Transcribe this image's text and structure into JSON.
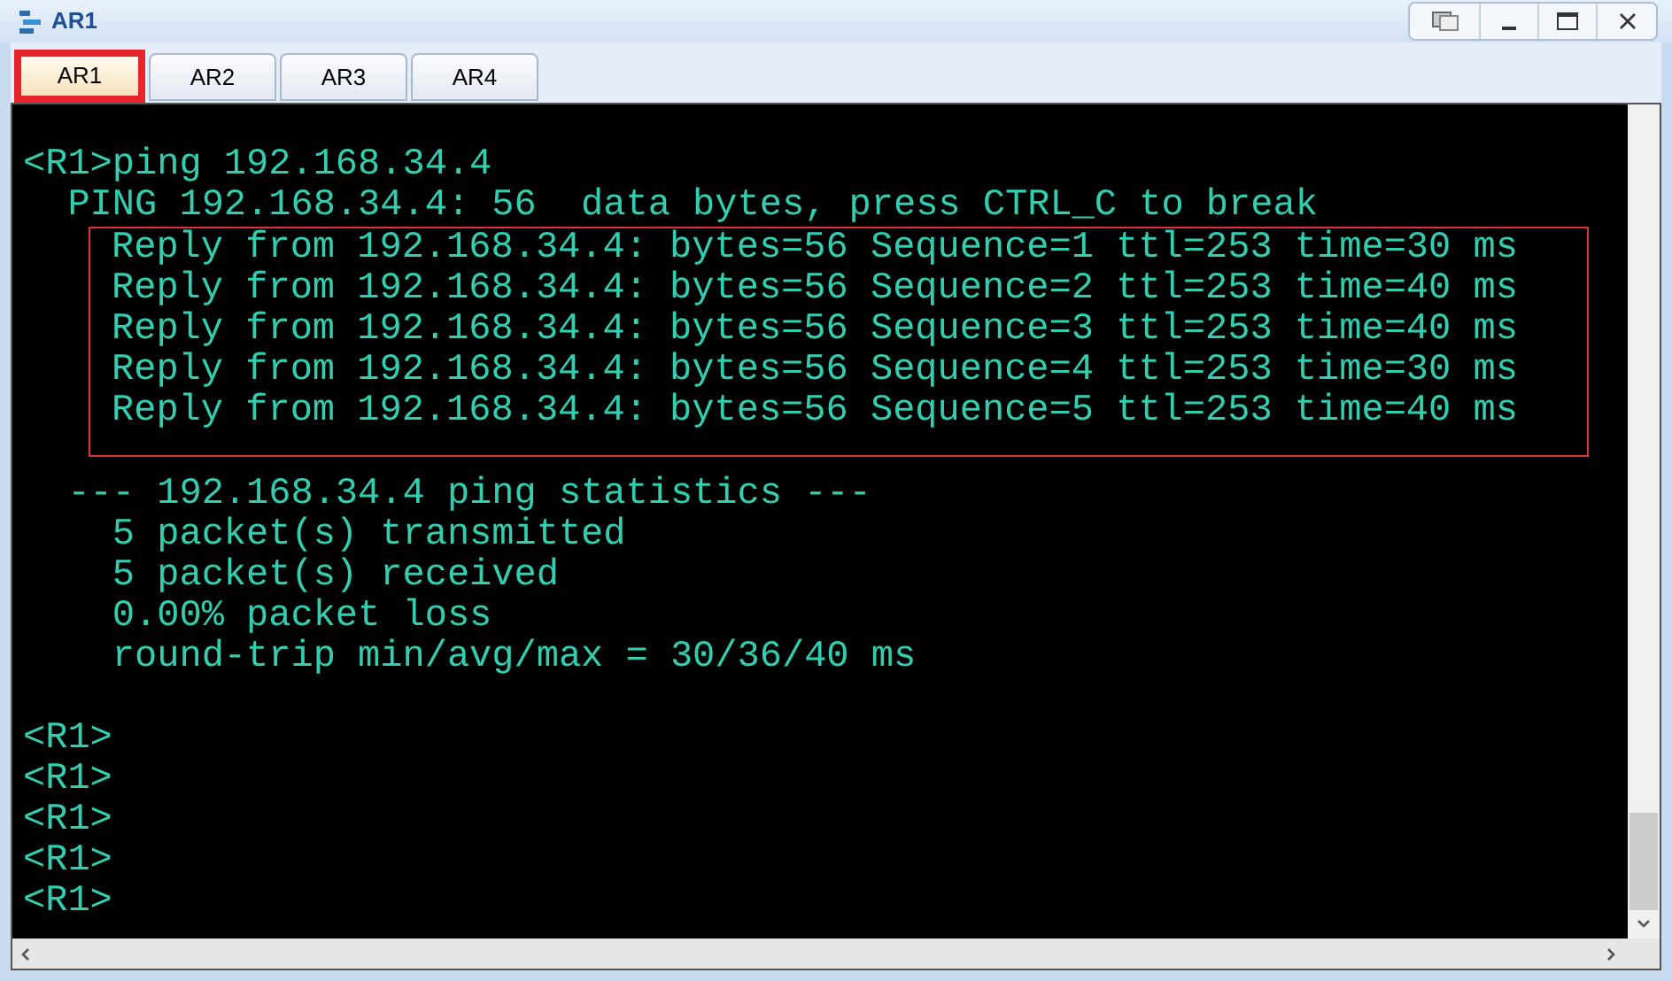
{
  "window": {
    "title": "AR1"
  },
  "tabs": [
    {
      "label": "AR1",
      "selected": true
    },
    {
      "label": "AR2",
      "selected": false
    },
    {
      "label": "AR3",
      "selected": false
    },
    {
      "label": "AR4",
      "selected": false
    }
  ],
  "terminal": {
    "lines_before": [
      "<R1>ping 192.168.34.4",
      "  PING 192.168.34.4: 56  data bytes, press CTRL_C to break"
    ],
    "highlighted_lines": [
      "Reply from 192.168.34.4: bytes=56 Sequence=1 ttl=253 time=30 ms",
      "Reply from 192.168.34.4: bytes=56 Sequence=2 ttl=253 time=40 ms",
      "Reply from 192.168.34.4: bytes=56 Sequence=3 ttl=253 time=40 ms",
      "Reply from 192.168.34.4: bytes=56 Sequence=4 ttl=253 time=30 ms",
      "Reply from 192.168.34.4: bytes=56 Sequence=5 ttl=253 time=40 ms"
    ],
    "statistics_lines": [
      "  --- 192.168.34.4 ping statistics ---",
      "    5 packet(s) transmitted",
      "    5 packet(s) received",
      "    0.00% packet loss",
      "    round-trip min/avg/max = 30/36/40 ms"
    ],
    "prompt_lines": [
      "<R1>",
      "<R1>",
      "<R1>",
      "<R1>",
      "<R1>"
    ]
  }
}
